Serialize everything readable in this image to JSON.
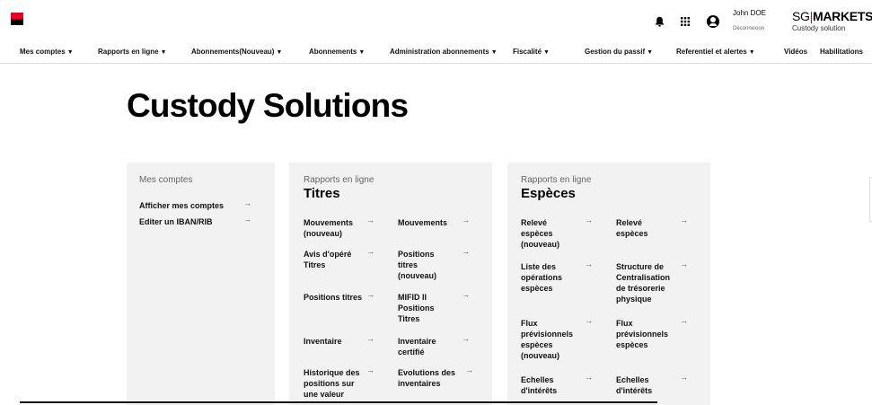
{
  "header": {
    "user_name": "John DOE",
    "logout_label": "Déconnexion",
    "brand_sg": "SG",
    "brand_sep": "|",
    "brand_markets": "MARKETS",
    "brand_sub": "Custody solution"
  },
  "nav": [
    {
      "label": "Mes comptes",
      "caret": "▼"
    },
    {
      "label": "Rapports en ligne",
      "caret": "▼"
    },
    {
      "label": "Abonnements(Nouveau)",
      "caret": "▼"
    },
    {
      "label": "Abonnements",
      "caret": "▼"
    },
    {
      "label": "Administration abonnements",
      "caret": "▼"
    },
    {
      "label": "Fiscalité",
      "caret": "▼"
    },
    {
      "label": "Gestion du passif",
      "caret": "▼"
    },
    {
      "label": "Referentiel et alertes",
      "caret": "▼"
    },
    {
      "label": "Vidéos",
      "caret": ""
    },
    {
      "label": "Habilitations",
      "caret": ""
    }
  ],
  "page_title": "Custody Solutions",
  "arrow": "→",
  "cards": {
    "mes_comptes": {
      "category": "Mes comptes",
      "links": [
        "Afficher mes comptes",
        "Editer un IBAN/RIB"
      ]
    },
    "titres": {
      "category": "Rapports en ligne",
      "title": "Titres",
      "links": [
        "Mouvements (nouveau)",
        "Mouvements",
        "Avis d'opéré Titres",
        "Positions titres (nouveau)",
        "Positions titres",
        "MIFID II Positions Titres",
        "Inventaire",
        "Inventaire certifié",
        "Historique des positions sur une valeur",
        "Evolutions des inventaires"
      ]
    },
    "especes": {
      "category": "Rapports en ligne",
      "title": "Espèces",
      "links": [
        "Relevé espèces (nouveau)",
        "Relevé espèces",
        "Liste des opérations espèces",
        "Structure de Centralisation de trésorerie physique",
        "Flux prévisionnels espèces (nouveau)",
        "Flux prévisionnels espèces",
        "Echelles d'intérêts",
        "Echelles d'intérêts"
      ]
    }
  }
}
